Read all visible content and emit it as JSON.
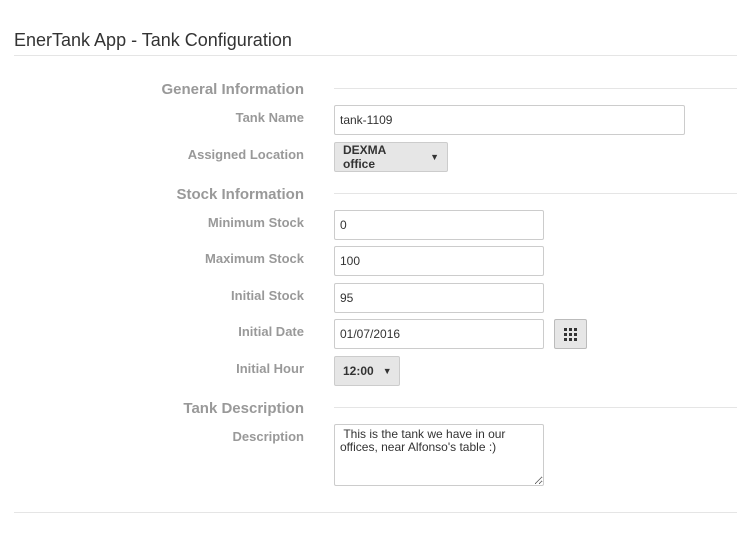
{
  "header": {
    "title": "EnerTank App - Tank Configuration"
  },
  "sections": {
    "general": {
      "title": "General Information",
      "tank_name": {
        "label": "Tank Name",
        "value": "tank-1109"
      },
      "assigned_location": {
        "label": "Assigned Location",
        "selected": "DEXMA office"
      }
    },
    "stock": {
      "title": "Stock Information",
      "minimum_stock": {
        "label": "Minimum Stock",
        "value": "0"
      },
      "maximum_stock": {
        "label": "Maximum Stock",
        "value": "100"
      },
      "initial_stock": {
        "label": "Initial Stock",
        "value": "95"
      },
      "initial_date": {
        "label": "Initial Date",
        "value": "01/07/2016",
        "calendar_icon": "calendar-grid-icon"
      },
      "initial_hour": {
        "label": "Initial Hour",
        "selected": "12:00"
      }
    },
    "description": {
      "title": "Tank Description",
      "description": {
        "label": "Description",
        "value": " This is the tank we have in our offices, near Alfonso's table :)"
      }
    }
  }
}
